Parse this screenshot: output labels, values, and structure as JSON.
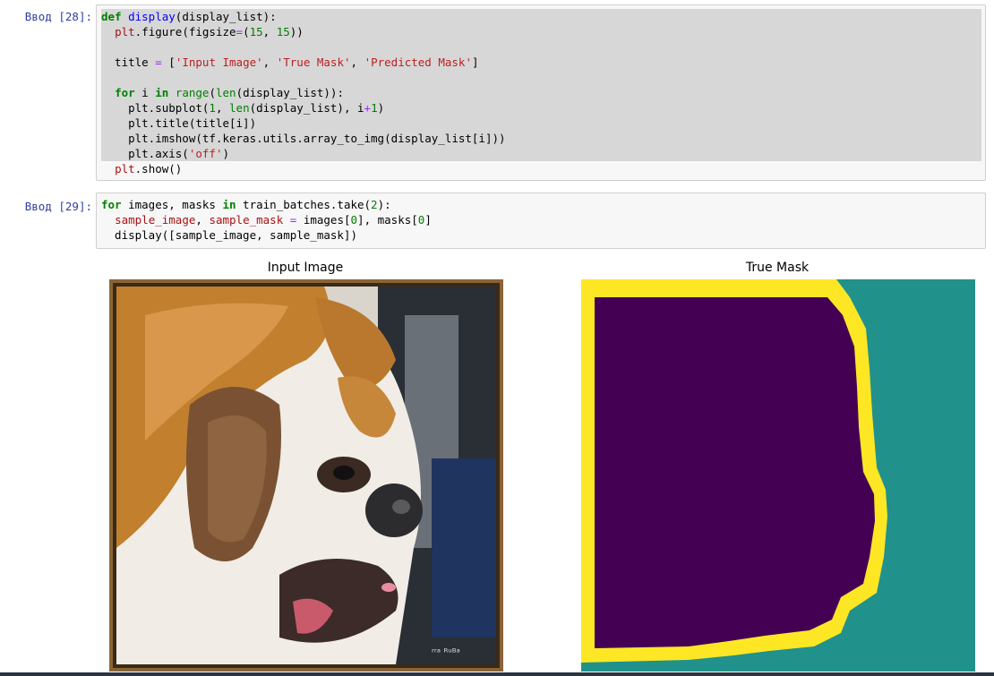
{
  "cells": [
    {
      "prompt": "Ввод [28]:",
      "lines": [
        "def display(display_list):",
        "  plt.figure(figsize=(15, 15))",
        "",
        "  title = ['Input Image', 'True Mask', 'Predicted Mask']",
        "",
        "  for i in range(len(display_list)):",
        "    plt.subplot(1, len(display_list), i+1)",
        "    plt.title(title[i])",
        "    plt.imshow(tf.keras.utils.array_to_img(display_list[i]))",
        "    plt.axis('off')",
        "  plt.show()"
      ]
    },
    {
      "prompt": "Ввод [29]:",
      "lines": [
        "for images, masks in train_batches.take(2):",
        "  sample_image, sample_mask = images[0], masks[0]",
        "  display([sample_image, sample_mask])"
      ]
    }
  ],
  "output": {
    "titles": [
      "Input Image",
      "True Mask"
    ],
    "image_description_icon": "dog-photo",
    "mask_colors": {
      "background": "#21918c",
      "border": "#fde725",
      "foreground": "#440154"
    }
  }
}
